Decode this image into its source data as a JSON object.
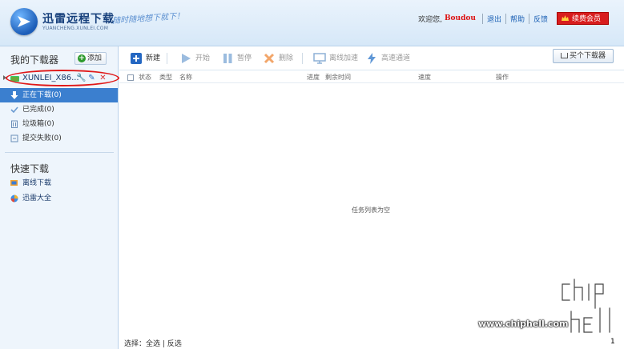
{
  "header": {
    "app_title": "迅雷远程下载",
    "app_subtitle": "YUANCHENG.XUNLEI.COM",
    "slogan": "随时随地想下就下！",
    "welcome": "欢迎您,",
    "username": "Boudou",
    "links": [
      "退出",
      "帮助",
      "反馈"
    ],
    "vip_button": "续费会员"
  },
  "sidebar": {
    "title": "我的下载器",
    "add_button": "添加",
    "device_name": "XUNLEI_X86...",
    "nav": [
      {
        "label": "正在下载(0)",
        "icon": "download-arrow-icon",
        "active": true
      },
      {
        "label": "已完成(0)",
        "icon": "check-icon",
        "active": false
      },
      {
        "label": "垃圾箱(0)",
        "icon": "trash-icon",
        "active": false
      },
      {
        "label": "提交失败(0)",
        "icon": "fail-icon",
        "active": false
      }
    ],
    "quick_title": "快速下载",
    "quick": [
      {
        "label": "离线下载",
        "icon": "offline-download-icon"
      },
      {
        "label": "迅雷大全",
        "icon": "xunlei-globe-icon"
      }
    ]
  },
  "toolbar": {
    "new": "新建",
    "start": "开始",
    "pause": "暂停",
    "delete": "删除",
    "offline_accel": "离线加速",
    "high_speed": "高速通道",
    "buy_downloader": "买个下载器"
  },
  "columns": [
    "状态",
    "类型",
    "名称",
    "进度",
    "剩余时间",
    "速度",
    "操作"
  ],
  "empty_message": "任务列表为空",
  "footer": {
    "select_label": "选择：",
    "select_all": "全选",
    "divider": " | ",
    "invert": "反选"
  },
  "watermark": "www.chiphell.com",
  "page_number": "1",
  "colors": {
    "active_nav": "#3b7fcf",
    "vip_red": "#d81d1d",
    "link_blue": "#1a5fb4",
    "annotation_red": "#e01818"
  }
}
